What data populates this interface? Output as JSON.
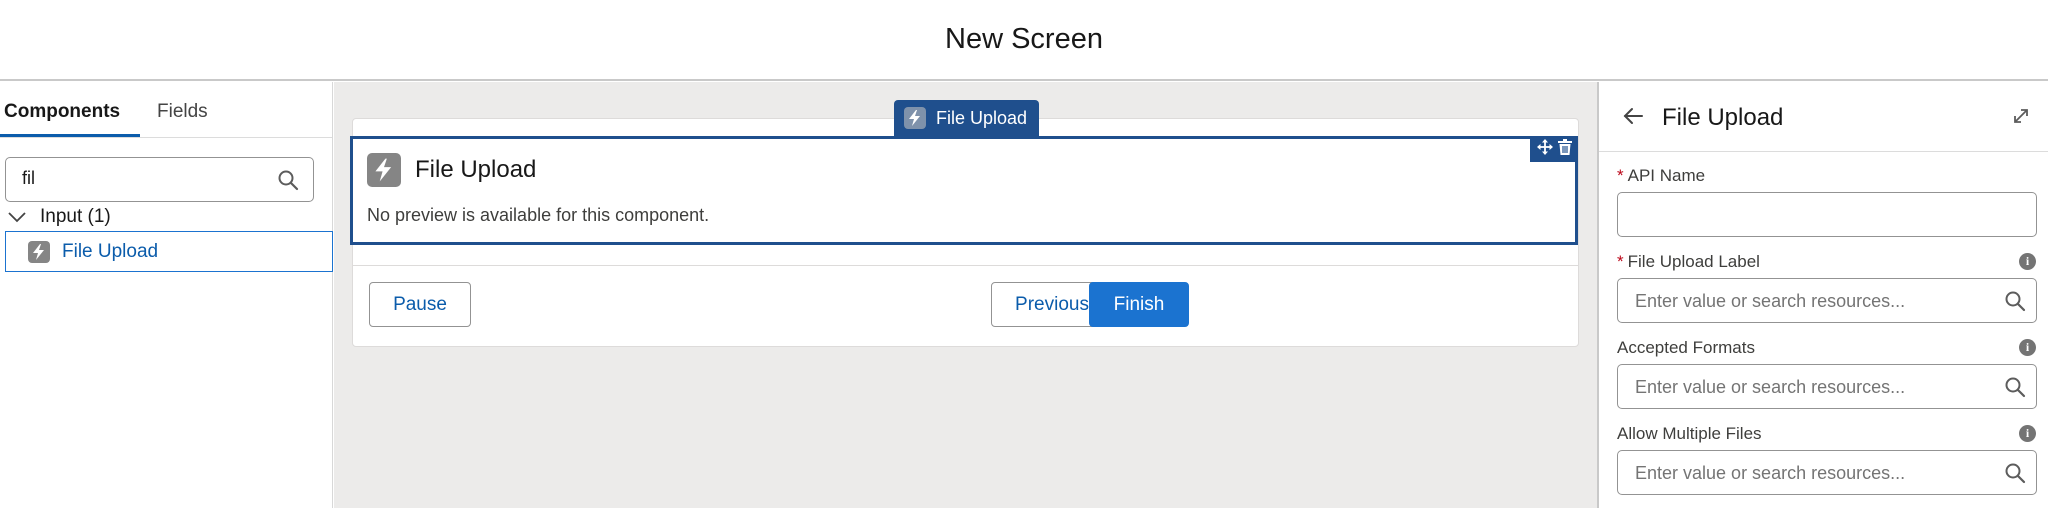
{
  "header": {
    "title": "New Screen"
  },
  "left_panel": {
    "tabs": [
      {
        "label": "Components",
        "active": true
      },
      {
        "label": "Fields",
        "active": false
      }
    ],
    "search": {
      "value": "fil",
      "icon": "search-icon"
    },
    "group": {
      "label": "Input (1)",
      "icon": "chevron-down-icon"
    },
    "items": [
      {
        "label": "File Upload",
        "icon": "lightning-icon"
      }
    ]
  },
  "canvas": {
    "component_tag": "File Upload",
    "component": {
      "title": "File Upload",
      "note": "No preview is available for this component."
    },
    "buttons": {
      "pause": "Pause",
      "previous": "Previous",
      "finish": "Finish"
    }
  },
  "properties": {
    "title": "File Upload",
    "fields": [
      {
        "label": "API Name",
        "required": true,
        "info": false,
        "value": "",
        "placeholder": ""
      },
      {
        "label": "File Upload Label",
        "required": true,
        "info": true,
        "value": "",
        "placeholder": "Enter value or search resources..."
      },
      {
        "label": "Accepted Formats",
        "required": false,
        "info": true,
        "value": "",
        "placeholder": "Enter value or search resources..."
      },
      {
        "label": "Allow Multiple Files",
        "required": false,
        "info": true,
        "value": "",
        "placeholder": "Enter value or search resources..."
      }
    ]
  },
  "colors": {
    "brand": "#1b73d0",
    "selection": "#1f4f8d",
    "link": "#0b5cab",
    "required": "#ba0517"
  }
}
